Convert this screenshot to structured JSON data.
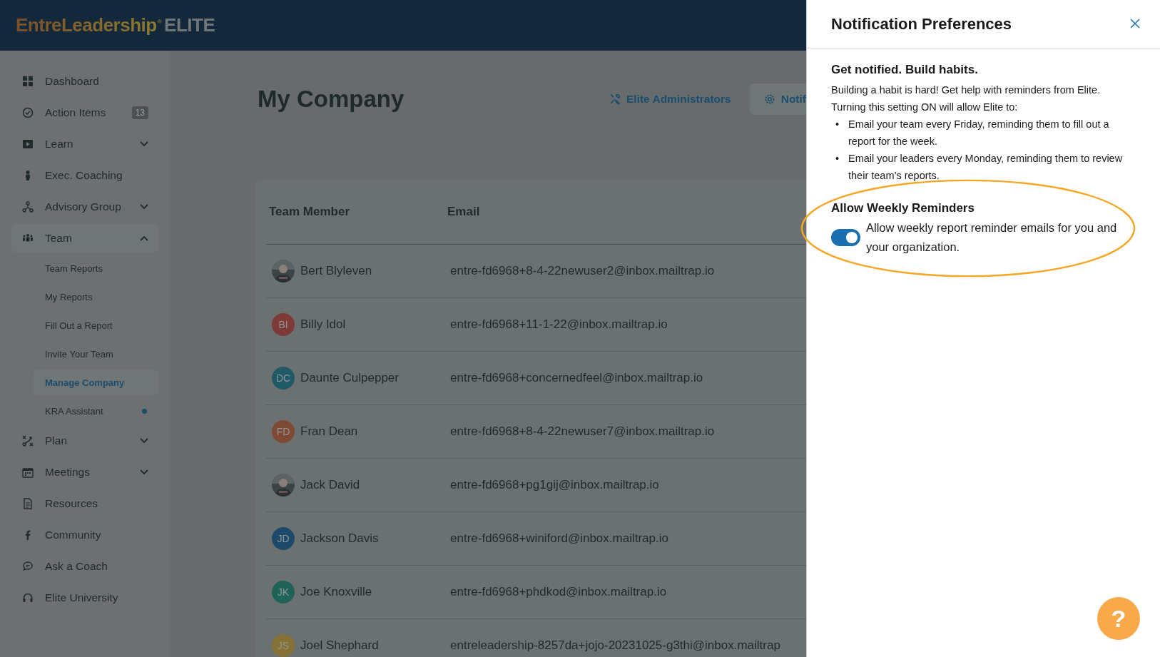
{
  "header": {
    "logo_brand": "EntreLeadership",
    "logo_mark": "®",
    "logo_product": "ELITE"
  },
  "sidebar": {
    "items": [
      {
        "label": "Dashboard",
        "selected": false
      },
      {
        "label": "Action Items",
        "badge": "13",
        "selected": false
      },
      {
        "label": "Learn",
        "expanded": false,
        "selected": false
      },
      {
        "label": "Exec. Coaching",
        "selected": false
      },
      {
        "label": "Advisory Group",
        "expanded": false,
        "selected": false
      },
      {
        "label": "Team",
        "expanded": true,
        "selected": false,
        "children": [
          {
            "label": "Team Reports",
            "selected": false
          },
          {
            "label": "My Reports",
            "selected": false
          },
          {
            "label": "Fill Out a Report",
            "selected": false
          },
          {
            "label": "Invite Your Team",
            "selected": false
          },
          {
            "label": "Manage Company",
            "selected": true
          },
          {
            "label": "KRA Assistant",
            "dot": true,
            "selected": false
          }
        ]
      },
      {
        "label": "Plan",
        "expanded": false,
        "selected": false
      },
      {
        "label": "Meetings",
        "expanded": false,
        "selected": false
      },
      {
        "label": "Resources",
        "selected": false
      },
      {
        "label": "Community",
        "selected": false
      },
      {
        "label": "Ask a Coach",
        "selected": false
      },
      {
        "label": "Elite University",
        "selected": false
      }
    ]
  },
  "page": {
    "title": "My Company",
    "actions": [
      {
        "label": "Elite Administrators",
        "kind": "link"
      },
      {
        "label": "Notif",
        "kind": "button"
      }
    ]
  },
  "table": {
    "columns": [
      "Team Member",
      "Email"
    ],
    "rows": [
      {
        "name": "Bert Blyleven",
        "email": "entre-fd6968+8-4-22newuser2@inbox.mailtrap.io"
      },
      {
        "name": "Billy Idol",
        "avatar": {
          "kind": "initials",
          "initials": "BI",
          "color": "#7e3a36"
        },
        "email": "entre-fd6968+11-1-22@inbox.mailtrap.io"
      },
      {
        "name": "Daunte Culpepper",
        "avatar": {
          "kind": "initials",
          "initials": "DC",
          "color": "#1f5a66"
        },
        "email": "entre-fd6968+concernedfeel@inbox.mailtrap.io"
      },
      {
        "name": "Fran Dean",
        "avatar": {
          "kind": "initials",
          "initials": "FD",
          "color": "#7f4a33"
        },
        "email": "entre-fd6968+8-4-22newuser7@inbox.mailtrap.io"
      },
      {
        "name": "Jack David",
        "email": "entre-fd6968+pg1gij@inbox.mailtrap.io"
      },
      {
        "name": "Jackson Davis",
        "avatar": {
          "kind": "initials",
          "initials": "JD",
          "color": "#1d4a6a"
        },
        "email": "entre-fd6968+winiford@inbox.mailtrap.io"
      },
      {
        "name": "Joe Knoxville",
        "avatar": {
          "kind": "initials",
          "initials": "JK",
          "color": "#1f6358"
        },
        "email": "entre-fd6968+phdkod@inbox.mailtrap.io"
      },
      {
        "name": "Joel Shephard",
        "avatar": {
          "kind": "initials",
          "initials": "JS",
          "color": "#857234"
        },
        "email": "entreleadership-8257da+jojo-20231025-g3thi@inbox.mailtrap"
      }
    ]
  },
  "drawer": {
    "title": "Notification Preferences",
    "heading": "Get notified. Build habits.",
    "intro": [
      "Building a habit is hard! Get help with reminders from Elite.",
      "Turning this setting ON will allow Elite to:"
    ],
    "bullets": [
      {
        "marker": "•",
        "text": "Email your team every Friday, reminding them to fill out a report for the week."
      },
      {
        "marker": "•",
        "text": "Email your leaders every Monday, reminding them to review their team’s reports."
      }
    ],
    "setting": {
      "title": "Allow Weekly Reminders",
      "label": "Allow weekly report reminder emails for you and your organization.",
      "on": true
    }
  },
  "help_button": {
    "label": "?"
  }
}
